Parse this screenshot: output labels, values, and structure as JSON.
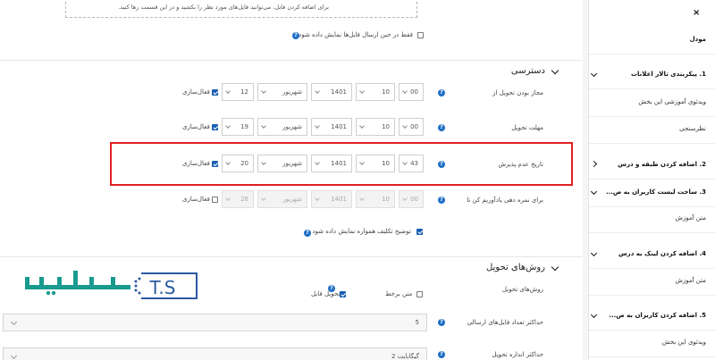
{
  "upload": {
    "hint": "برای اضافه کردن فایل، می‌توانید فایل‌های مورد نظر را بکشید و در این قسمت رها کنید."
  },
  "only_first_send": {
    "label": "فقط در حین ارسال فایل‌ها نمایش داده شود",
    "checked": false
  },
  "availability": {
    "title": "دسترسی",
    "enable_label": "فعال‌سازی",
    "rows": [
      {
        "label": "مجاز بودن تحویل از",
        "day": "12",
        "month": "شهریور",
        "year": "1401",
        "hour": "10",
        "minute": "00",
        "enabled": true
      },
      {
        "label": "مهلت تحویل",
        "day": "19",
        "month": "شهریور",
        "year": "1401",
        "hour": "10",
        "minute": "00",
        "enabled": true
      },
      {
        "label": "تاریخ عدم پذیرش",
        "day": "20",
        "month": "شهریور",
        "year": "1401",
        "hour": "10",
        "minute": "43",
        "enabled": true
      },
      {
        "label": "برای نمره دهی یادآوریم کن تا",
        "day": "26",
        "month": "شهریور",
        "year": "1401",
        "hour": "10",
        "minute": "00",
        "enabled": false
      }
    ],
    "always_show_desc": {
      "label": "توضیح تکلیف همواره نمایش داده شود",
      "checked": true
    }
  },
  "submission": {
    "title": "روش‌های تحویل",
    "types_label": "روش‌های تحویل",
    "online_text": "متن برخط",
    "file_submission": "تحویل فایل",
    "max_files_label": "حداکثر تعداد فایل‌های ارسالی",
    "max_files_value": "5",
    "max_size_label": "حداکثر اندازه تحویل",
    "max_size_value": "2 گیگابایت"
  },
  "logo": {
    "text": "تهران",
    "initials": "T.S"
  },
  "drawer": {
    "close": "×",
    "items": [
      {
        "label": "مودل",
        "head": true
      },
      {
        "label": "1. پیکربندی تالار اعلانات",
        "head": true
      },
      {
        "label": "ویدئوی آموزشی این بخش",
        "head": false
      },
      {
        "label": "نظرسنجی",
        "head": false
      },
      {
        "label": "2. اضافه کردن طبقه و درس",
        "head": true
      },
      {
        "label": "3. ساخت لیست کاربران به ص...",
        "head": true
      },
      {
        "label": "متن آموزش",
        "head": false
      },
      {
        "label": "4. اضافه کردن لینک به درس",
        "head": true
      },
      {
        "label": "متن آموزش",
        "head": false
      },
      {
        "label": "5. اضافه کردن کاربران به ص...",
        "head": true
      },
      {
        "label": "ویدئوی این بخش",
        "head": false
      }
    ]
  }
}
